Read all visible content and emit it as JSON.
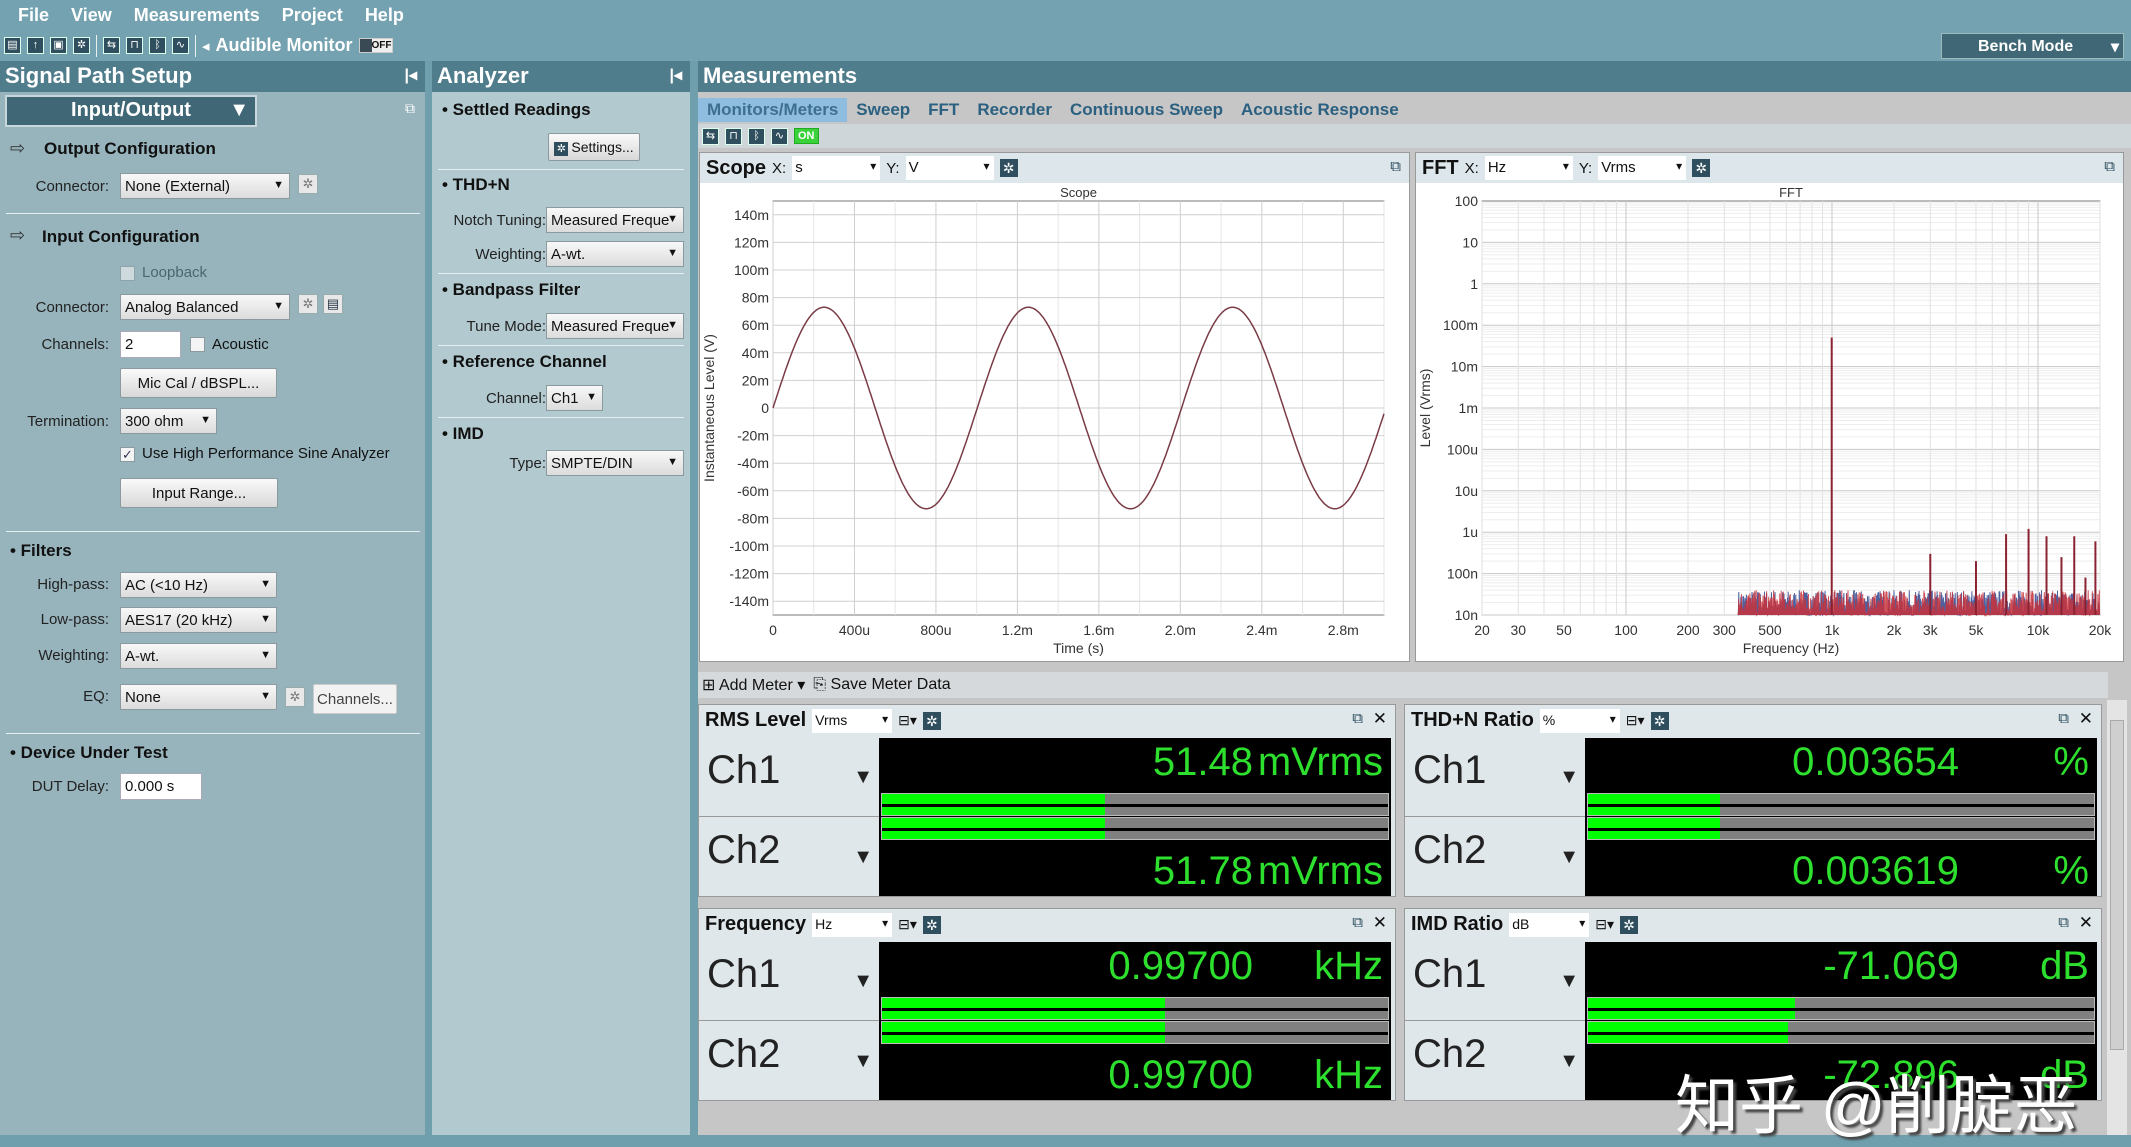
{
  "menu": [
    "File",
    "View",
    "Measurements",
    "Project",
    "Help"
  ],
  "toolbar": {
    "audible_monitor": "Audible Monitor",
    "audible_state": "OFF",
    "bench_mode": "Bench Mode"
  },
  "signal_path": {
    "title": "Signal Path Setup",
    "view_select": "Input/Output",
    "output_config": {
      "title": "Output Configuration",
      "connector_label": "Connector:",
      "connector": "None (External)"
    },
    "input_config": {
      "title": "Input Configuration",
      "loopback": "Loopback",
      "connector_label": "Connector:",
      "connector": "Analog Balanced",
      "channels_label": "Channels:",
      "channels": "2",
      "acoustic": "Acoustic",
      "mic_cal": "Mic Cal / dBSPL...",
      "termination_label": "Termination:",
      "termination": "300 ohm",
      "high_perf": "Use High Performance Sine Analyzer",
      "high_perf_checked": true,
      "input_range": "Input Range..."
    },
    "filters": {
      "title": "Filters",
      "highpass_label": "High-pass:",
      "highpass": "AC (<10 Hz)",
      "lowpass_label": "Low-pass:",
      "lowpass": "AES17 (20 kHz)",
      "weighting_label": "Weighting:",
      "weighting": "A-wt.",
      "eq_label": "EQ:",
      "eq": "None",
      "channels_btn": "Channels..."
    },
    "dut": {
      "title": "Device Under Test",
      "delay_label": "DUT Delay:",
      "delay": "0.000 s"
    }
  },
  "analyzer": {
    "title": "Analyzer",
    "settled": "Settled Readings",
    "settings_btn": "Settings...",
    "thdn": "THD+N",
    "notch_label": "Notch Tuning:",
    "notch": "Measured Freque",
    "weight_label": "Weighting:",
    "weight": "A-wt.",
    "bandpass": "Bandpass Filter",
    "tune_label": "Tune Mode:",
    "tune": "Measured Freque",
    "ref": "Reference Channel",
    "channel_label": "Channel:",
    "channel": "Ch1",
    "imd": "IMD",
    "type_label": "Type:",
    "type": "SMPTE/DIN"
  },
  "measurements": {
    "title": "Measurements",
    "tabs": [
      "Monitors/Meters",
      "Sweep",
      "FFT",
      "Recorder",
      "Continuous Sweep",
      "Acoustic Response"
    ],
    "active_tab": 0,
    "generator_state": "ON",
    "add_meter": "Add Meter",
    "save_meter": "Save Meter Data"
  },
  "scope": {
    "title": "Scope",
    "x_unit": "s",
    "y_unit": "V"
  },
  "fft": {
    "title": "FFT",
    "x_unit": "Hz",
    "y_unit": "Vrms"
  },
  "chart_data": [
    {
      "type": "line",
      "title": "Scope",
      "xlabel": "Time (s)",
      "ylabel": "Instantaneous Level (V)",
      "xlim": [
        0,
        0.003
      ],
      "ylim": [
        -0.15,
        0.15
      ],
      "xticks": [
        "0",
        "400u",
        "800u",
        "1.2m",
        "1.6m",
        "2.0m",
        "2.4m",
        "2.8m"
      ],
      "xtick_values": [
        0,
        0.0004,
        0.0008,
        0.0012,
        0.0016,
        0.002,
        0.0024,
        0.0028
      ],
      "yticks": [
        "140m",
        "120m",
        "100m",
        "80m",
        "60m",
        "40m",
        "20m",
        "0",
        "-20m",
        "-40m",
        "-60m",
        "-80m",
        "-100m",
        "-120m",
        "-140m"
      ],
      "ytick_values": [
        0.14,
        0.12,
        0.1,
        0.08,
        0.06,
        0.04,
        0.02,
        0,
        -0.02,
        -0.04,
        -0.06,
        -0.08,
        -0.1,
        -0.12,
        -0.14
      ],
      "grid": true,
      "series": [
        {
          "waveform": "sine",
          "amplitude_v": 0.073,
          "frequency_hz": 997,
          "color": "#7a3b45"
        }
      ]
    },
    {
      "type": "line",
      "title": "FFT",
      "xlabel": "Frequency (Hz)",
      "ylabel": "Level (Vrms)",
      "xscale": "log",
      "yscale": "log",
      "xlim": [
        20,
        20000
      ],
      "ylim": [
        1e-08,
        100
      ],
      "xticks": [
        "20",
        "30",
        "50",
        "100",
        "200",
        "300",
        "500",
        "1k",
        "2k",
        "3k",
        "5k",
        "10k",
        "20k"
      ],
      "xtick_values": [
        20,
        30,
        50,
        100,
        200,
        300,
        500,
        1000,
        2000,
        3000,
        5000,
        10000,
        20000
      ],
      "yticks": [
        "100",
        "10",
        "1",
        "100m",
        "10m",
        "1m",
        "100u",
        "10u",
        "1u",
        "100n",
        "10n"
      ],
      "ytick_values": [
        100,
        10,
        1,
        0.1,
        0.01,
        0.001,
        0.0001,
        1e-05,
        1e-06,
        1e-07,
        1e-08
      ],
      "grid": true,
      "noise_floor_vrms": [
        1e-08,
        4e-08
      ],
      "noise_start_hz": 350,
      "peaks": [
        {
          "f": 997,
          "v": 0.05
        },
        {
          "f": 3000,
          "v": 3e-07
        },
        {
          "f": 5000,
          "v": 2e-07
        },
        {
          "f": 7000,
          "v": 9e-07
        },
        {
          "f": 9000,
          "v": 1.2e-06
        },
        {
          "f": 11000,
          "v": 8e-07
        },
        {
          "f": 13000,
          "v": 2.5e-07
        },
        {
          "f": 15000,
          "v": 8e-07
        },
        {
          "f": 17000,
          "v": 8e-08
        },
        {
          "f": 19000,
          "v": 6e-07
        }
      ],
      "series_colors": [
        "#3b4f94",
        "#c8323c"
      ]
    }
  ],
  "meters": [
    {
      "title": "RMS Level",
      "unit": "Vrms",
      "channels": [
        {
          "name": "Ch1",
          "value": "51.48",
          "unit": "mVrms",
          "fraction": 0.44
        },
        {
          "name": "Ch2",
          "value": "51.78",
          "unit": "mVrms",
          "fraction": 0.44
        }
      ]
    },
    {
      "title": "THD+N Ratio",
      "unit": "%",
      "channels": [
        {
          "name": "Ch1",
          "value": "0.003654",
          "unit": "%",
          "fraction": 0.26
        },
        {
          "name": "Ch2",
          "value": "0.003619",
          "unit": "%",
          "fraction": 0.26
        }
      ]
    },
    {
      "title": "Frequency",
      "unit": "Hz",
      "channels": [
        {
          "name": "Ch1",
          "value": "0.99700",
          "unit": "kHz",
          "fraction": 0.56
        },
        {
          "name": "Ch2",
          "value": "0.99700",
          "unit": "kHz",
          "fraction": 0.56
        }
      ]
    },
    {
      "title": "IMD Ratio",
      "unit": "dB",
      "channels": [
        {
          "name": "Ch1",
          "value": "-71.069",
          "unit": "dB",
          "fraction": 0.41
        },
        {
          "name": "Ch2",
          "value": "-72.896",
          "unit": "dB",
          "fraction": 0.395
        }
      ]
    }
  ],
  "watermark": "知乎 @削腚恶",
  "colors": {
    "meter_text": "#2ee02e",
    "meter_bar": "#00ff00",
    "header": "#507d8c",
    "active_tab": "#8fbde0"
  }
}
